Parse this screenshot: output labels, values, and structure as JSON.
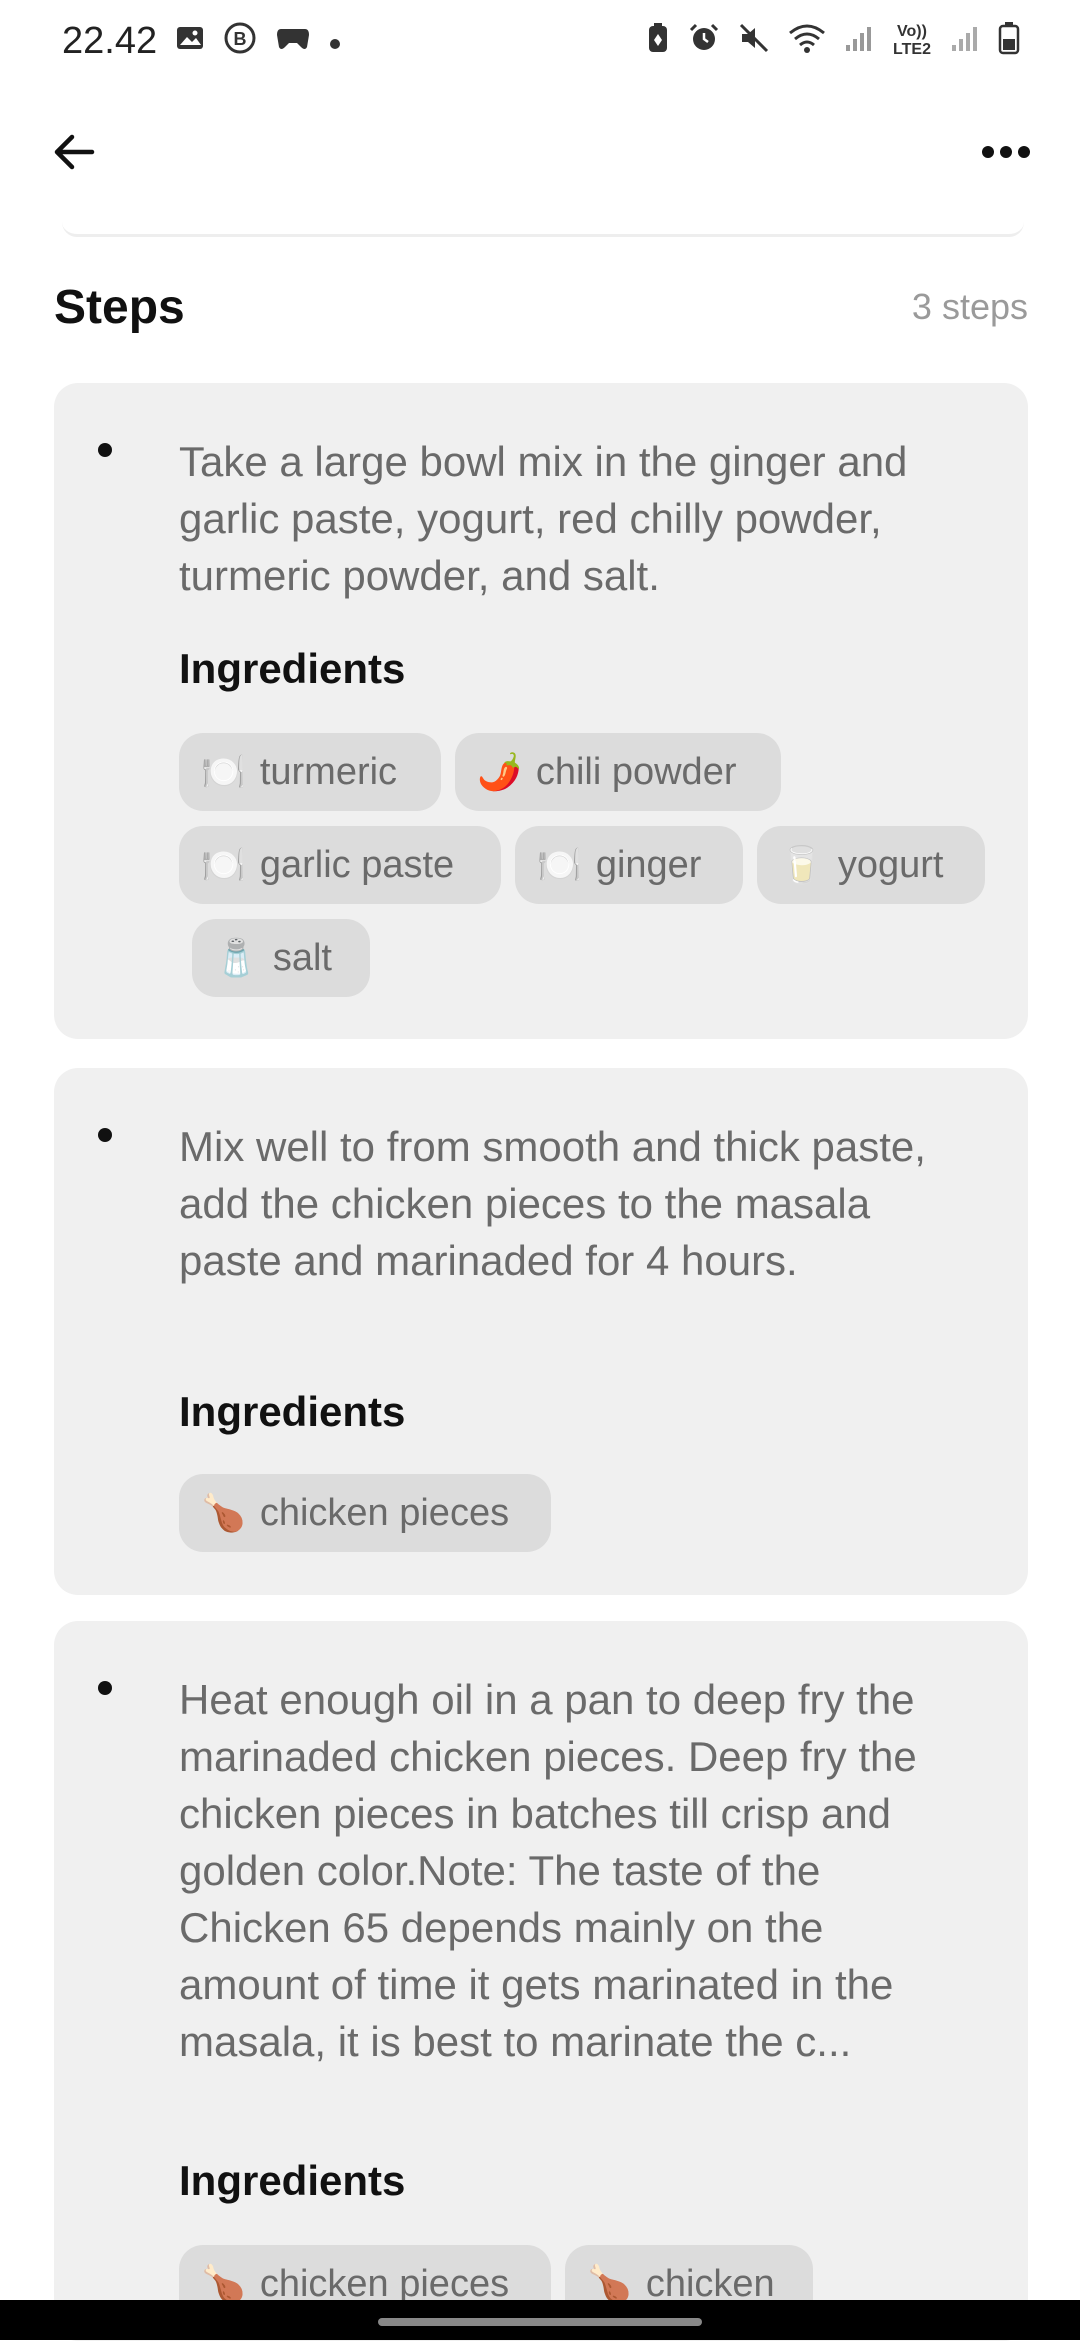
{
  "status_bar": {
    "time": "22.42",
    "left_icons": [
      "image-icon",
      "b-badge-icon",
      "game-controller-icon",
      "dot-icon"
    ],
    "right_icons": [
      "battery-saver-icon",
      "alarm-icon",
      "mute-icon",
      "wifi-icon",
      "signal-icon",
      "volte-icon",
      "signal-icon-2",
      "battery-icon"
    ],
    "volte_label": "Vo)) LTE2"
  },
  "app_bar": {
    "back_icon": "arrow-left-icon",
    "more_icon": "more-horizontal-icon"
  },
  "steps": {
    "title": "Steps",
    "count": "3 steps",
    "ingredients_label": "Ingredients",
    "items": [
      {
        "text": "Take a large bowl mix in the ginger and garlic paste, yogurt, red chilly powder, turmeric powder, and salt.",
        "ingredients": [
          {
            "emoji": "🍽️",
            "name": "turmeric"
          },
          {
            "emoji": "🌶️",
            "name": "chili powder"
          },
          {
            "emoji": "🍽️",
            "name": "garlic paste"
          },
          {
            "emoji": "🍽️",
            "name": "ginger"
          },
          {
            "emoji": "🥛",
            "name": "yogurt"
          },
          {
            "emoji": "🧂",
            "name": "salt"
          }
        ]
      },
      {
        "text": "Mix well to from smooth and thick paste, add the chicken pieces to the masala paste and  marinaded for 4 hours.",
        "ingredients": [
          {
            "emoji": "🍗",
            "name": "chicken pieces"
          }
        ]
      },
      {
        "text": "Heat enough oil in a pan to deep fry the marinaded chicken pieces. Deep fry the chicken pieces in batches till crisp and golden color.Note: The taste of the Chicken 65 depends mainly on the amount of time it gets marinated in the masala, it is best to marinate the c...",
        "ingredients": [
          {
            "emoji": "🍗",
            "name": "chicken pieces"
          },
          {
            "emoji": "🍗",
            "name": "chicken"
          }
        ]
      }
    ]
  }
}
